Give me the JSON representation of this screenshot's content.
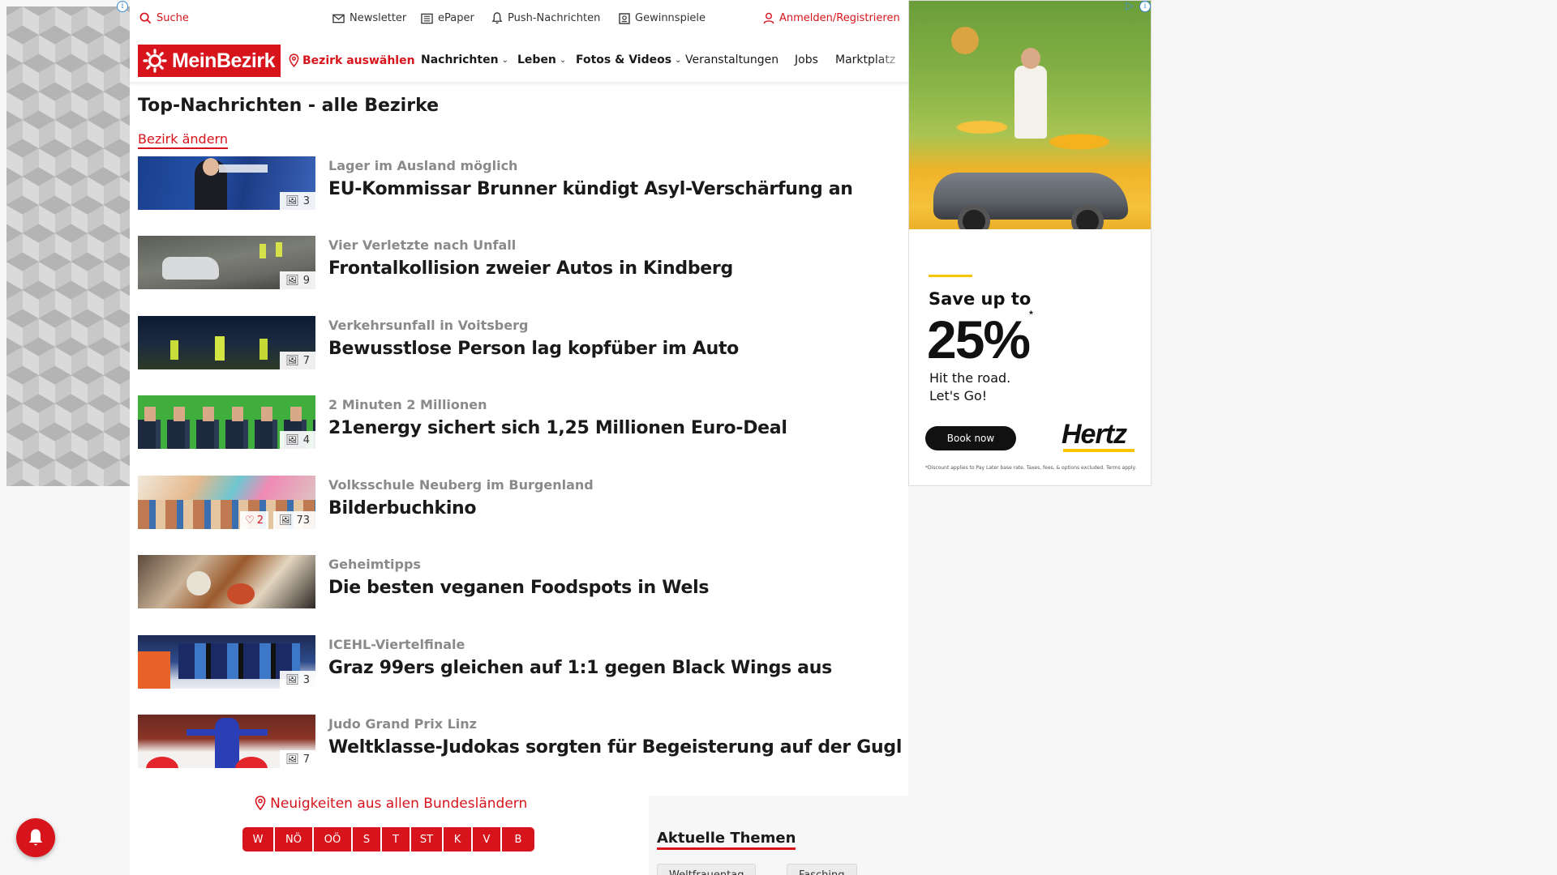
{
  "topbar": {
    "search": "Suche",
    "newsletter": "Newsletter",
    "epaper": "ePaper",
    "push": "Push-Nachrichten",
    "gewinnspiele": "Gewinnspiele",
    "login": "Anmelden/Registrieren"
  },
  "nav": {
    "logo": "MeinBezirk",
    "bezirk": "Bezirk auswählen",
    "items": [
      "Nachrichten",
      "Leben",
      "Fotos & Videos",
      "Veranstaltungen",
      "Jobs",
      "Marktplatz"
    ]
  },
  "page": {
    "title": "Top-Nachrichten - alle Bezirke",
    "change_link": "Bezirk ändern"
  },
  "articles": [
    {
      "kicker": "Lager im Ausland möglich",
      "headline": "EU-Kommissar Brunner kündigt Asyl-Verschärfung an",
      "photos": "3"
    },
    {
      "kicker": "Vier Verletzte nach Unfall",
      "headline": "Frontalkollision zweier Autos in Kindberg",
      "photos": "9"
    },
    {
      "kicker": "Verkehrsunfall in Voitsberg",
      "headline": "Bewusstlose Person lag kopfüber im Auto",
      "photos": "7"
    },
    {
      "kicker": "2 Minuten 2 Millionen",
      "headline": "21energy sichert sich 1,25 Millionen Euro-Deal",
      "photos": "4"
    },
    {
      "kicker": "Volksschule Neuberg im Burgenland",
      "headline": "Bilderbuchkino",
      "photos": "73",
      "likes": "2"
    },
    {
      "kicker": "Geheimtipps",
      "headline": "Die besten veganen Foodspots in Wels",
      "photos": ""
    },
    {
      "kicker": "ICEHL-Viertelfinale",
      "headline": "Graz 99ers gleichen auf 1:1 gegen Black Wings aus",
      "photos": "3"
    },
    {
      "kicker": "Judo Grand Prix Linz",
      "headline": "Weltklasse-Judokas sorgten für Begeisterung auf der Gugl",
      "photos": "7"
    }
  ],
  "footer": {
    "bundeslaender_link": "Neuigkeiten aus allen Bundesländern",
    "states": [
      "W",
      "NÖ",
      "OÖ",
      "S",
      "T",
      "ST",
      "K",
      "V",
      "B"
    ],
    "themen_title": "Aktuelle Themen",
    "themen": [
      "Weltfrauentag",
      "Fasching"
    ]
  },
  "ad": {
    "save": "Save up to",
    "percent": "25%",
    "asterisk": "*",
    "tagline1": "Hit the road.",
    "tagline2": "Let's Go!",
    "button": "Book now",
    "brand": "Hertz",
    "fine_print": "*Discount applies to Pay Later base rate. Taxes, fees, & options excluded. Terms apply."
  },
  "colors": {
    "brand_red": "#d7141b",
    "ad_yellow": "#f6c400"
  }
}
